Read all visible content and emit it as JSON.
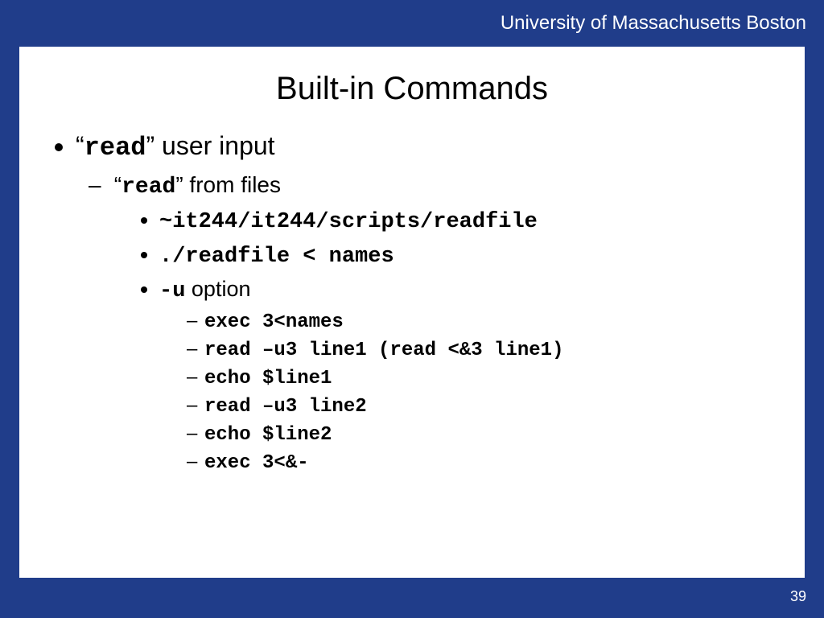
{
  "header": {
    "org": "University of Massachusetts Boston"
  },
  "slide": {
    "title": "Built-in Commands",
    "bullet1_quote_open": "“",
    "bullet1_cmd": "read",
    "bullet1_quote_close": "”",
    "bullet1_rest": " user input",
    "bullet2_quote_open": "“",
    "bullet2_cmd": "read",
    "bullet2_quote_close": "”",
    "bullet2_rest": " from files",
    "l3_1": "~it244/it244/scripts/readfile",
    "l3_2": "./readfile < names",
    "l3_3_cmd": "-u",
    "l3_3_rest": "  option",
    "l4_1": "exec 3<names",
    "l4_2": "read –u3 line1  (read <&3 line1)",
    "l4_3": "echo $line1",
    "l4_4": "read –u3 line2",
    "l4_5": "echo $line2",
    "l4_6": "exec 3<&-"
  },
  "page": "39"
}
